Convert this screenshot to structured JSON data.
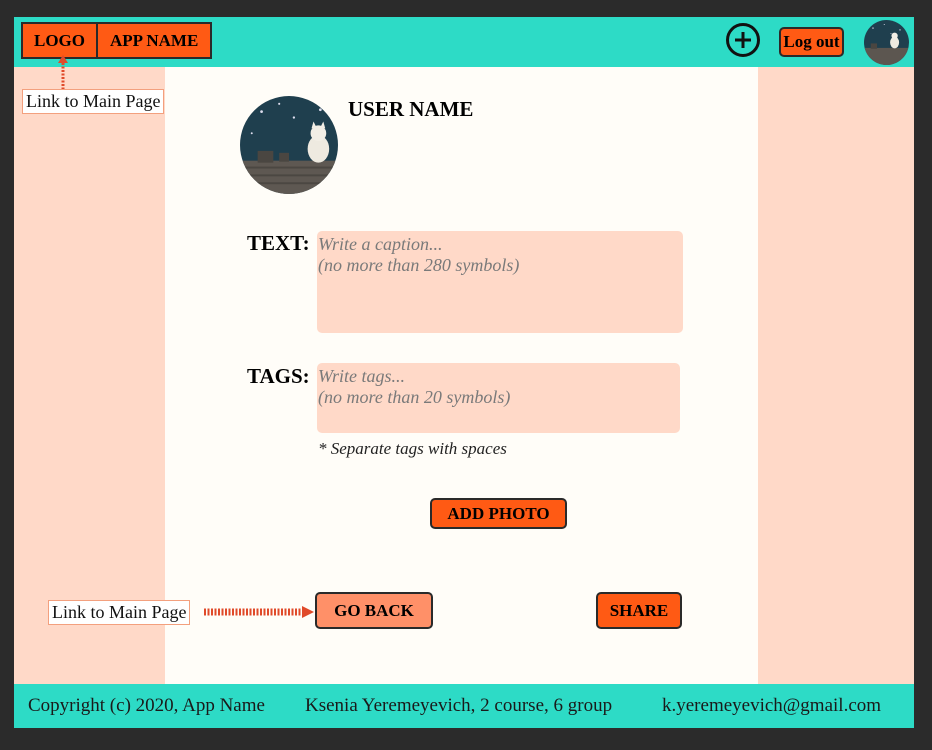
{
  "header": {
    "logo": "LOGO",
    "app_name": "APP NAME",
    "logout_label": "Log out"
  },
  "annotations": {
    "logo_note": "Link to Main Page",
    "goback_note": "Link to Main Page"
  },
  "profile": {
    "user_name": "USER NAME"
  },
  "form": {
    "text_label": "TEXT:",
    "text_placeholder_line1": "Write a caption...",
    "text_placeholder_line2": "(no more than 280 symbols)",
    "tags_label": "TAGS:",
    "tags_placeholder_line1": "Write tags...",
    "tags_placeholder_line2": "(no more than 20 symbols)",
    "tags_hint": "* Separate tags with spaces",
    "add_photo_label": "ADD PHOTO"
  },
  "actions": {
    "go_back_label": "GO BACK",
    "share_label": "SHARE"
  },
  "footer": {
    "copyright": "Copyright (c) 2020, App Name",
    "author": "Ksenia Yeremeyevich, 2 course, 6 group",
    "email": "k.yeremeyevich@gmail.com"
  },
  "colors": {
    "accent": "#ff5a14",
    "header_bg": "#2ddbc6",
    "side_bg": "#ffd9c8",
    "content_bg": "#fffdf8",
    "arrow": "#e04a2a"
  },
  "icons": {
    "add": "plus-circle-icon",
    "avatar": "cat-on-roof-avatar"
  }
}
